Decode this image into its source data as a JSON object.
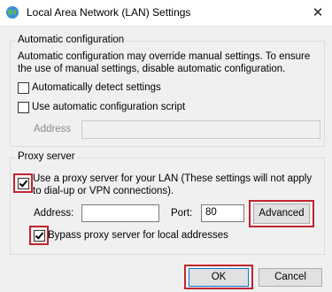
{
  "window": {
    "title": "Local Area Network (LAN) Settings",
    "close_glyph": "✕",
    "app_icon": "network-globe-icon"
  },
  "auto_config": {
    "legend": "Automatic configuration",
    "description": "Automatic configuration may override manual settings.  To ensure the use of manual settings, disable automatic configuration.",
    "detect_label": "Automatically detect settings",
    "detect_checked": false,
    "script_label": "Use automatic configuration script",
    "script_checked": false,
    "address_label": "Address",
    "address_value": ""
  },
  "proxy": {
    "legend": "Proxy server",
    "use_proxy_label": "Use a proxy server for your LAN (These settings will not apply to dial-up or VPN connections).",
    "use_proxy_checked": true,
    "address_label": "Address:",
    "address_value": "",
    "port_label": "Port:",
    "port_value": "80",
    "advanced_label": "Advanced",
    "bypass_label": "Bypass proxy server for local addresses",
    "bypass_checked": true
  },
  "buttons": {
    "ok": "OK",
    "cancel": "Cancel"
  },
  "colors": {
    "highlight": "#c0262f",
    "focus_border": "#0078d7"
  }
}
